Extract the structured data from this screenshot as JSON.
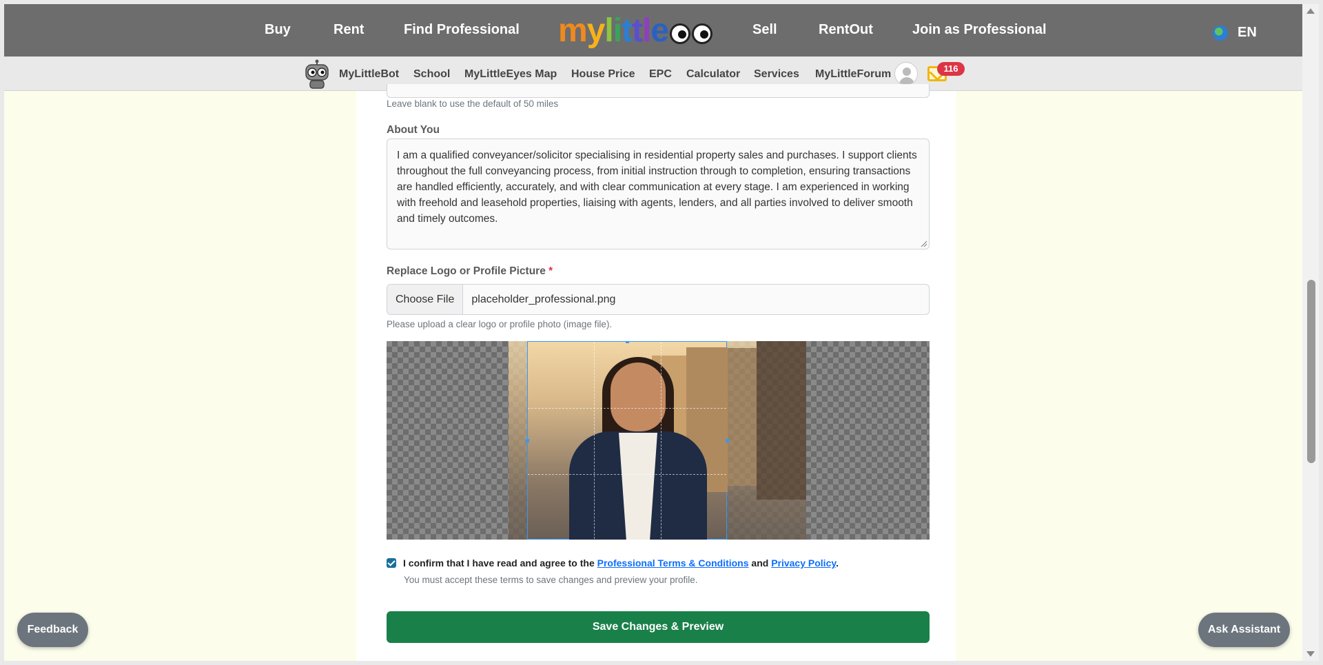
{
  "topnav": {
    "links": [
      "Buy",
      "Rent",
      "Find Professional",
      "Sell",
      "RentOut",
      "Join as Professional"
    ],
    "logo_text": "mylittle",
    "language": "EN"
  },
  "subnav": {
    "items": [
      "MyLittleBot",
      "School",
      "MyLittleEyes Map",
      "House Price",
      "EPC",
      "Calculator",
      "Services",
      "MyLittleForum"
    ],
    "active": "MyLittleEyes Map",
    "notification_count": "116"
  },
  "form": {
    "radius_hint": "Leave blank to use the default of 50 miles",
    "about_label": "About You",
    "about_text": "I am a qualified conveyancer/solicitor specialising in residential property sales and purchases. I support clients throughout the full conveyancing process, from initial instruction through to completion, ensuring transactions are handled efficiently, accurately, and with clear communication at every stage. I am experienced in working with freehold and leasehold properties, liaising with agents, lenders, and all parties involved to deliver smooth and timely outcomes.",
    "logo_label": "Replace Logo or Profile Picture",
    "required_mark": "*",
    "choose_file": "Choose File",
    "file_name": "placeholder_professional.png",
    "logo_hint": "Please upload a clear logo or profile photo (image file).",
    "terms_prefix": "I confirm that I have read and agree to the",
    "terms_link": "Professional Terms & Conditions",
    "terms_and": "and",
    "privacy_link": "Privacy Policy",
    "terms_suffix": ".",
    "terms_checked": true,
    "terms_hint": "You must accept these terms to save changes and preview your profile.",
    "save_label": "Save Changes & Preview"
  },
  "floating": {
    "feedback": "Feedback",
    "assistant": "Ask Assistant"
  },
  "colors": {
    "topnav_bg": "#6d6d6d",
    "page_bg": "#fdfdec",
    "save_button": "#198049",
    "badge": "#dc3545",
    "link": "#0d6efd"
  }
}
